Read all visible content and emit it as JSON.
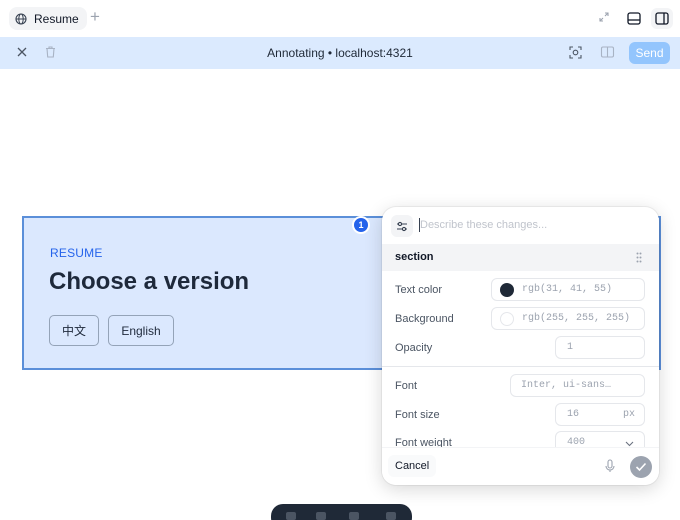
{
  "tab": {
    "title": "Resume",
    "icon": "globe-icon"
  },
  "toolbar": {
    "title": "Annotating • localhost:4321",
    "send_label": "Send"
  },
  "page": {
    "eyebrow": "RESUME",
    "heading": "Choose a version",
    "lang_buttons": [
      "中文",
      "English"
    ],
    "badge": "1"
  },
  "panel": {
    "placeholder": "Describe these changes...",
    "section_name": "section",
    "text_color": {
      "label": "Text color",
      "value": "rgb(31, 41, 55)",
      "swatch": "#1f2937"
    },
    "background": {
      "label": "Background",
      "value": "rgb(255, 255, 255)",
      "swatch": "#ffffff"
    },
    "opacity": {
      "label": "Opacity",
      "value": "1"
    },
    "font": {
      "label": "Font",
      "value": "Inter, ui-sans…"
    },
    "font_size": {
      "label": "Font size",
      "value": "16",
      "unit": "px"
    },
    "font_weight": {
      "label": "Font weight",
      "value": "400"
    },
    "cancel_label": "Cancel"
  },
  "colors": {
    "accent": "#2563eb",
    "selection_fill": "#dbe8fe",
    "selection_border": "#5b8fd9",
    "toolbar_bg": "#dbeafe",
    "send_bg": "#93c5fd"
  }
}
